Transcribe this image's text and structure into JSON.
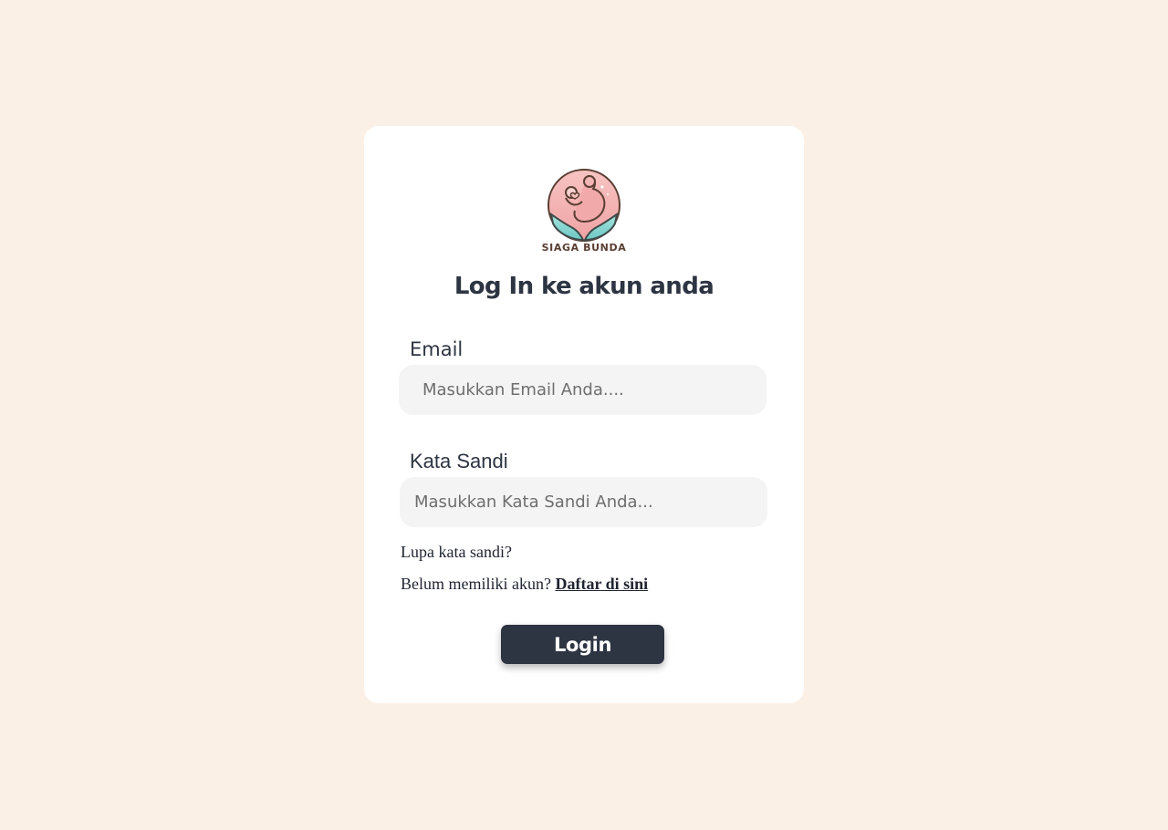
{
  "brand": {
    "name": "SIAGA BUNDA"
  },
  "page": {
    "title": "Log In ke akun anda"
  },
  "form": {
    "email": {
      "label": "Email",
      "placeholder": "Masukkan Email Anda....",
      "value": ""
    },
    "password": {
      "label": "Kata Sandi",
      "placeholder": "Masukkan Kata Sandi Anda...",
      "value": ""
    },
    "forgot_link": "Lupa kata sandi?",
    "register_prompt": "Belum memiliki akun?",
    "register_link": "Daftar di sini",
    "submit_label": "Login"
  },
  "colors": {
    "background": "#FBF0E6",
    "card": "#FFFFFF",
    "primary": "#2D3442",
    "input_bg": "#F4F4F4",
    "logo_pink": "#F4B6B4",
    "logo_teal": "#7FD3CF"
  },
  "icons": {
    "logo": "mother-baby-hands-icon"
  }
}
